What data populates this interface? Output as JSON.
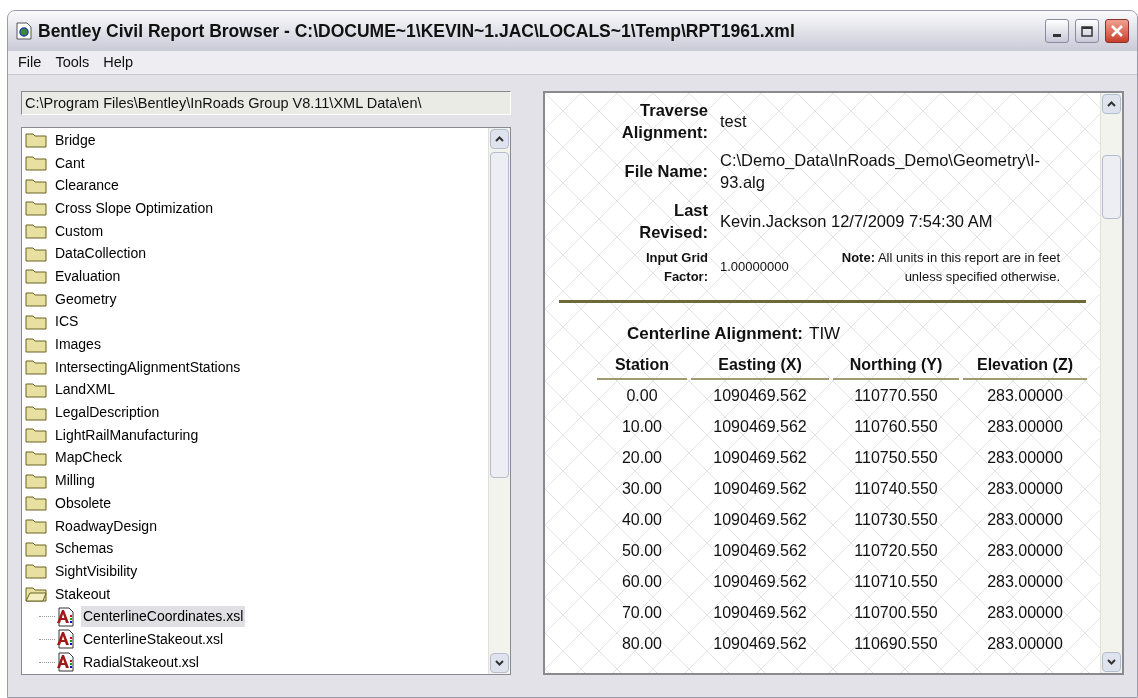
{
  "window": {
    "title": "Bentley Civil Report Browser - C:\\DOCUME~1\\KEVIN~1.JAC\\LOCALS~1\\Temp\\RPT1961.xml"
  },
  "menu": [
    "File",
    "Tools",
    "Help"
  ],
  "path_field": {
    "value": "C:\\Program Files\\Bentley\\InRoads Group V8.11\\XML Data\\en\\"
  },
  "tree": {
    "items": [
      {
        "label": "Bridge",
        "kind": "folder",
        "selected": false,
        "expanded": false
      },
      {
        "label": "Cant",
        "kind": "folder",
        "selected": false,
        "expanded": false
      },
      {
        "label": "Clearance",
        "kind": "folder",
        "selected": false,
        "expanded": false
      },
      {
        "label": "Cross Slope Optimization",
        "kind": "folder",
        "selected": false,
        "expanded": false
      },
      {
        "label": "Custom",
        "kind": "folder",
        "selected": false,
        "expanded": false
      },
      {
        "label": "DataCollection",
        "kind": "folder",
        "selected": false,
        "expanded": false
      },
      {
        "label": "Evaluation",
        "kind": "folder",
        "selected": false,
        "expanded": false
      },
      {
        "label": "Geometry",
        "kind": "folder",
        "selected": false,
        "expanded": false
      },
      {
        "label": "ICS",
        "kind": "folder",
        "selected": false,
        "expanded": false
      },
      {
        "label": "Images",
        "kind": "folder",
        "selected": false,
        "expanded": false
      },
      {
        "label": "IntersectingAlignmentStations",
        "kind": "folder",
        "selected": false,
        "expanded": false
      },
      {
        "label": "LandXML",
        "kind": "folder",
        "selected": false,
        "expanded": false
      },
      {
        "label": "LegalDescription",
        "kind": "folder",
        "selected": false,
        "expanded": false
      },
      {
        "label": "LightRailManufacturing",
        "kind": "folder",
        "selected": false,
        "expanded": false
      },
      {
        "label": "MapCheck",
        "kind": "folder",
        "selected": false,
        "expanded": false
      },
      {
        "label": "Milling",
        "kind": "folder",
        "selected": false,
        "expanded": false
      },
      {
        "label": "Obsolete",
        "kind": "folder",
        "selected": false,
        "expanded": false
      },
      {
        "label": "RoadwayDesign",
        "kind": "folder",
        "selected": false,
        "expanded": false
      },
      {
        "label": "Schemas",
        "kind": "folder",
        "selected": false,
        "expanded": false
      },
      {
        "label": "SightVisibility",
        "kind": "folder",
        "selected": false,
        "expanded": false
      },
      {
        "label": "Stakeout",
        "kind": "folder",
        "selected": false,
        "expanded": true,
        "children": [
          {
            "label": "CenterlineCoordinates.xsl",
            "kind": "file",
            "selected": true
          },
          {
            "label": "CenterlineStakeout.xsl",
            "kind": "file",
            "selected": false
          },
          {
            "label": "RadialStakeout.xsl",
            "kind": "file",
            "selected": false
          }
        ]
      }
    ]
  },
  "report": {
    "header": [
      {
        "label": "Traverse Alignment:",
        "value": "test"
      },
      {
        "label": "File Name:",
        "value": "C:\\Demo_Data\\InRoads_Demo\\Geometry\\I-93.alg"
      },
      {
        "label": "Last Revised:",
        "value": "Kevin.Jackson 12/7/2009 7:54:30 AM"
      }
    ],
    "grid_factor": {
      "label": "Input Grid Factor:",
      "value": "1.00000000"
    },
    "note": {
      "label": "Note:",
      "text": "All units in this report are in feet unless specified otherwise."
    },
    "centerline": {
      "label": "Centerline Alignment:",
      "value": "TIW"
    },
    "table": {
      "columns": [
        "Station",
        "Easting (X)",
        "Northing (Y)",
        "Elevation (Z)"
      ],
      "rows": [
        [
          "0.00",
          "1090469.562",
          "110770.550",
          "283.00000"
        ],
        [
          "10.00",
          "1090469.562",
          "110760.550",
          "283.00000"
        ],
        [
          "20.00",
          "1090469.562",
          "110750.550",
          "283.00000"
        ],
        [
          "30.00",
          "1090469.562",
          "110740.550",
          "283.00000"
        ],
        [
          "40.00",
          "1090469.562",
          "110730.550",
          "283.00000"
        ],
        [
          "50.00",
          "1090469.562",
          "110720.550",
          "283.00000"
        ],
        [
          "60.00",
          "1090469.562",
          "110710.550",
          "283.00000"
        ],
        [
          "70.00",
          "1090469.562",
          "110700.550",
          "283.00000"
        ],
        [
          "80.00",
          "1090469.562",
          "110690.550",
          "283.00000"
        ]
      ]
    }
  }
}
